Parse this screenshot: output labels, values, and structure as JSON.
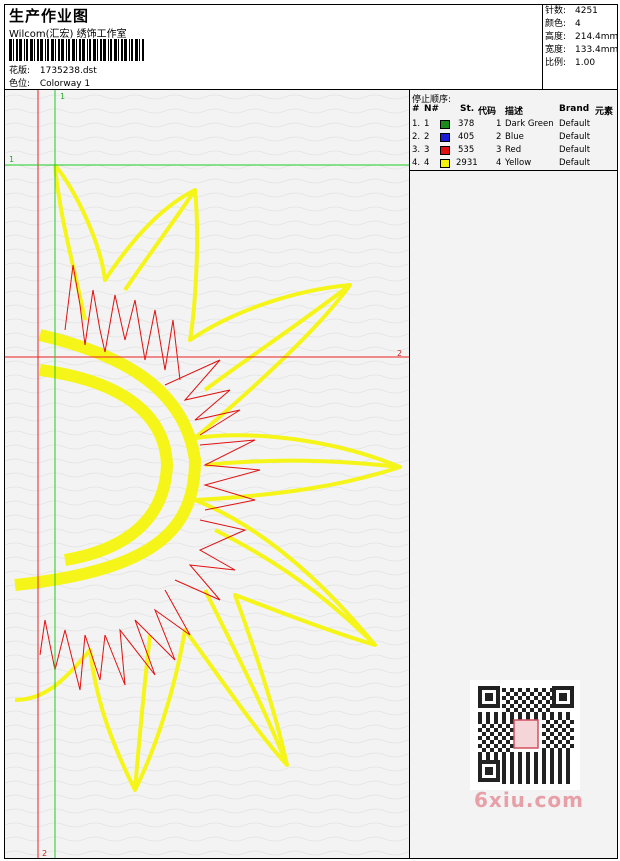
{
  "header": {
    "title": "生产作业图",
    "company": "Wilcom(汇宏) 绣饰工作室",
    "pattern_label": "花版:",
    "pattern_value": "1735238.dst",
    "colorway_label": "色位:",
    "colorway_value": "Colorway 1"
  },
  "stats": [
    {
      "key": "针数:",
      "value": "4251"
    },
    {
      "key": "颜色:",
      "value": "4"
    },
    {
      "key": "高度:",
      "value": "214.4mm"
    },
    {
      "key": "宽度:",
      "value": "133.4mm"
    },
    {
      "key": "比例:",
      "value": "1.00"
    }
  ],
  "guides": {
    "label_1": "1",
    "label_2": "2"
  },
  "stop_sequence": {
    "title": "停止顺序:",
    "columns": [
      "#",
      "N#",
      "St.",
      "代码",
      "描述",
      "Brand",
      "元素"
    ],
    "rows": [
      {
        "num": "1.",
        "n": "1",
        "color": "#1a8a1a",
        "st": "378",
        "code": "1",
        "desc": "Dark Green",
        "brand": "Default"
      },
      {
        "num": "2.",
        "n": "2",
        "color": "#1a1ad8",
        "st": "405",
        "code": "2",
        "desc": "Blue",
        "brand": "Default"
      },
      {
        "num": "3.",
        "n": "3",
        "color": "#e01010",
        "st": "535",
        "code": "3",
        "desc": "Red",
        "brand": "Default"
      },
      {
        "num": "4.",
        "n": "4",
        "color": "#f2f20a",
        "st": "2931",
        "code": "4",
        "desc": "Yellow",
        "brand": "Default"
      }
    ]
  },
  "colors": {
    "yellow_stitch": "#f5f51a",
    "red_stitch": "#e01010",
    "guide_green": "#22cc22",
    "guide_red": "#ee2222"
  },
  "watermark": "6xiu.com"
}
